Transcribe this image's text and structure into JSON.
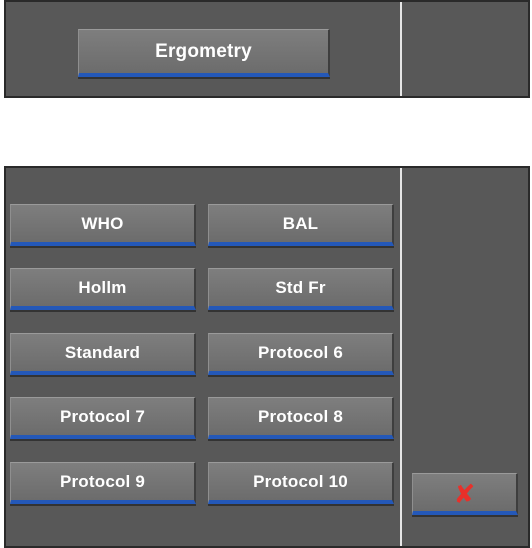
{
  "header": {
    "ergometry_label": "Ergometry"
  },
  "protocols": {
    "items": [
      {
        "label": "WHO"
      },
      {
        "label": "BAL"
      },
      {
        "label": "Hollm"
      },
      {
        "label": "Std Fr"
      },
      {
        "label": "Standard"
      },
      {
        "label": "Protocol 6"
      },
      {
        "label": "Protocol 7"
      },
      {
        "label": "Protocol 8"
      },
      {
        "label": "Protocol 9"
      },
      {
        "label": "Protocol 10"
      }
    ]
  },
  "close": {
    "icon": "✘",
    "icon_name": "close-x-icon",
    "icon_color": "#e8302a"
  },
  "colors": {
    "panel_bg": "#585858",
    "button_bg": "#757575",
    "button_accent": "#2458b8",
    "divider": "#e6e6e6"
  }
}
